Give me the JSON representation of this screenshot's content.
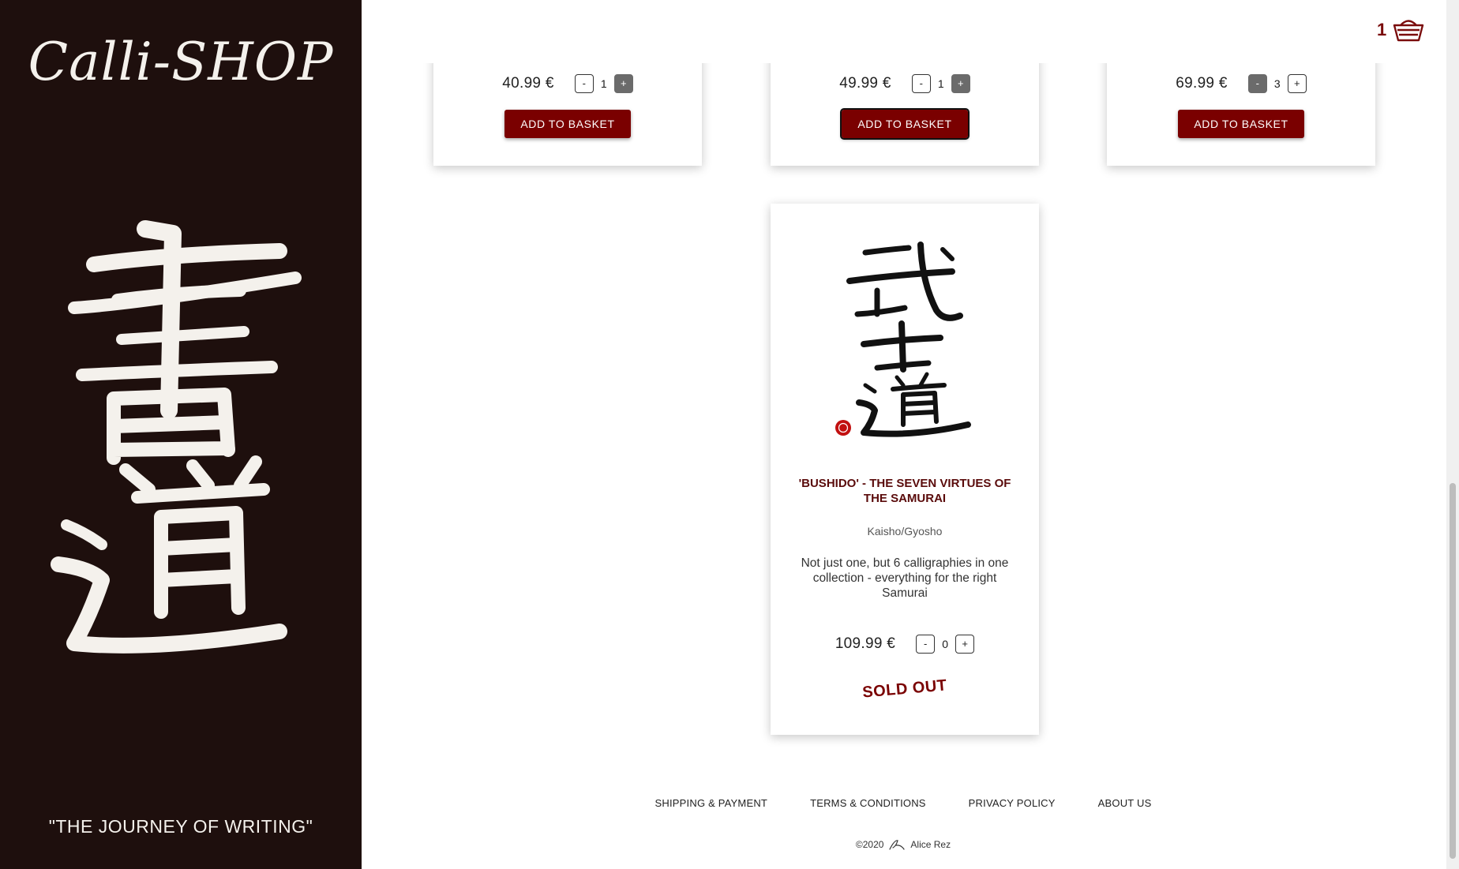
{
  "sidebar": {
    "brand": "Calli-SHOP",
    "tagline": "\"THE JOURNEY OF WRITING\""
  },
  "basket": {
    "count": "1",
    "icon": "basket-icon"
  },
  "top_products": [
    {
      "price": "40.99 €",
      "quantity": "1",
      "add_label": "ADD TO BASKET"
    },
    {
      "price": "49.99 €",
      "quantity": "1",
      "add_label": "ADD TO BASKET"
    },
    {
      "price": "69.99 €",
      "quantity": "3",
      "add_label": "ADD TO BASKET"
    }
  ],
  "featured_product": {
    "title": "'BUSHIDO' - THE SEVEN VIRTUES OF THE SAMURAI",
    "style": "Kaisho/Gyosho",
    "description": "Not just one, but 6 calligraphies in one collection - everything for the right Samurai",
    "price": "109.99 €",
    "quantity": "0",
    "status": "SOLD OUT"
  },
  "qty_controls": {
    "minus": "-",
    "plus": "+"
  },
  "footer": {
    "links": [
      "SHIPPING & PAYMENT",
      "TERMS & CONDITIONS",
      "PRIVACY POLICY",
      "ABOUT US"
    ],
    "copyright_year": "©2020",
    "author": "Alice Rez"
  },
  "colors": {
    "sidebar_bg": "#1e0f0d",
    "accent": "#7a0000",
    "title": "#5a0b0b"
  }
}
